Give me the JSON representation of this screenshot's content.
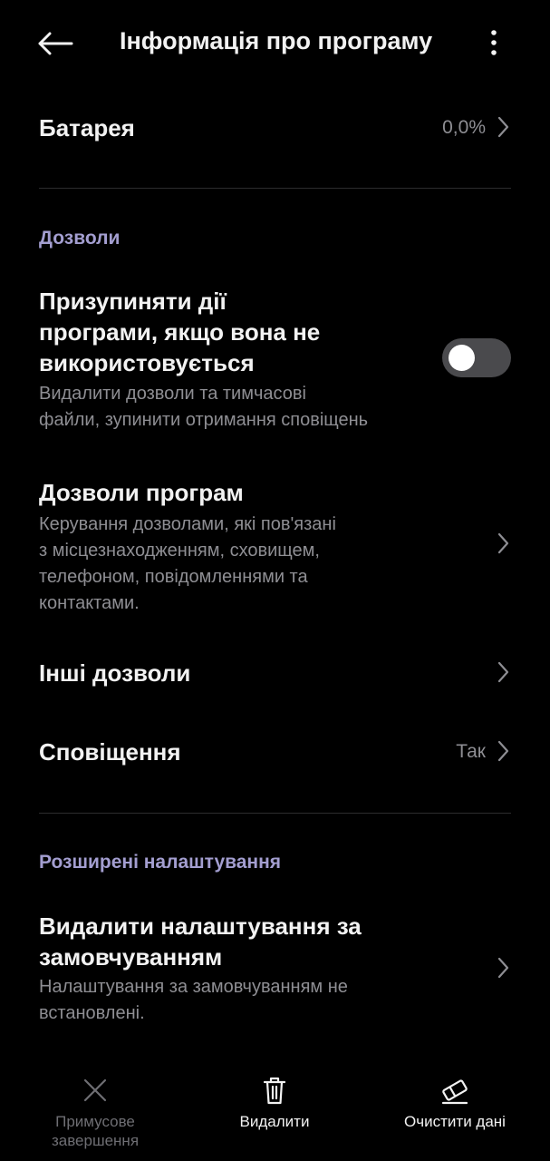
{
  "header": {
    "title": "Інформація про програму",
    "back_icon": "arrow-left-icon",
    "more_icon": "more-vertical-icon"
  },
  "battery": {
    "label": "Батарея",
    "value": "0,0%"
  },
  "permissions_section": {
    "label": "Дозволи",
    "pause_activity": {
      "title_lines": [
        "Призупиняти дії",
        "програми, якщо вона не",
        "використовується"
      ],
      "subtitle_lines": [
        "Видалити дозволи та тимчасові",
        "файли, зупинити отримання сповіщень"
      ],
      "toggle_on": false
    },
    "app_permissions": {
      "title": "Дозволи програм",
      "subtitle_lines": [
        "Керування дозволами, які пов'язані",
        "з місцезнаходженням, сховищем,",
        "телефоном, повідомленнями та",
        "контактами."
      ]
    },
    "other_permissions": {
      "title": "Інші дозволи"
    },
    "notifications": {
      "title": "Сповіщення",
      "value": "Так"
    }
  },
  "advanced_section": {
    "label": "Розширені налаштування",
    "clear_defaults": {
      "title_lines": [
        "Видалити налаштування за",
        "замовчуванням"
      ],
      "subtitle_lines": [
        "Налаштування за замовчуванням не",
        "встановлені."
      ]
    }
  },
  "bottom_bar": {
    "force_stop": {
      "label_lines": [
        "Примусове",
        "завершення"
      ],
      "icon": "close-x-icon",
      "enabled": false
    },
    "uninstall": {
      "label": "Видалити",
      "icon": "trash-icon"
    },
    "clear_data": {
      "label": "Очистити дані",
      "icon": "eraser-icon"
    }
  },
  "colors": {
    "background": "#000000",
    "primary_text": "#f2f2f2",
    "secondary_text": "#8e8e93",
    "section_label": "#a39ed0",
    "disabled_text": "#6e6e73"
  }
}
